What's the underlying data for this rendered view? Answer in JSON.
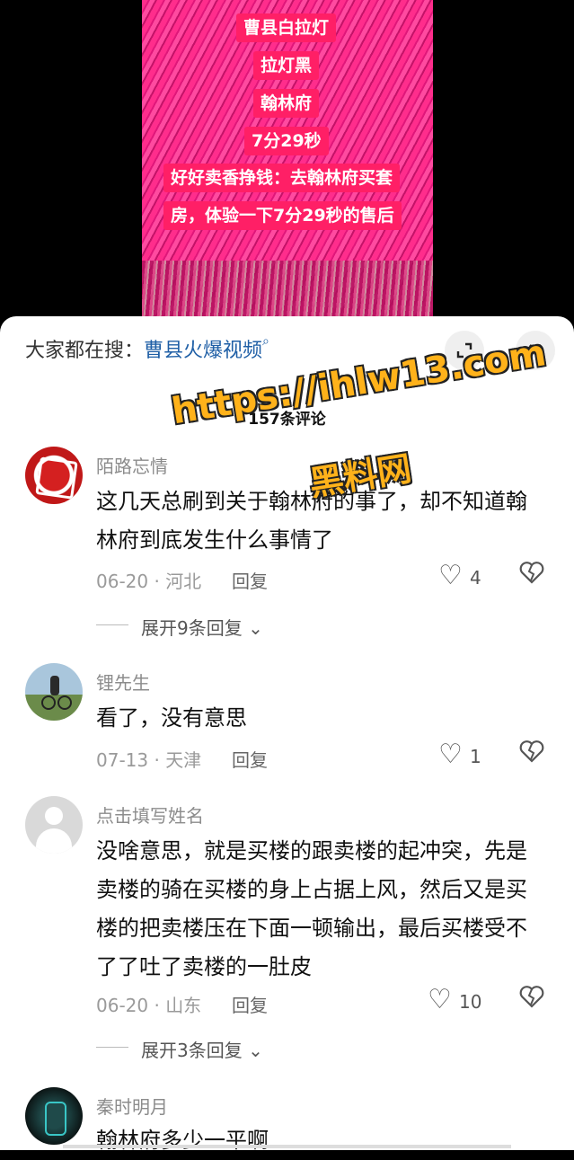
{
  "video": {
    "captions": [
      "曹县白拉灯",
      "拉灯黑",
      "翰林府",
      "7分29秒",
      "好好卖香挣钱：去翰林府买套",
      "房，体验一下7分29秒的售后"
    ]
  },
  "sheet": {
    "search_prefix": "大家都在搜：",
    "search_term": "曹县火爆视频",
    "comment_count": "157条评论"
  },
  "watermark": {
    "line1": "https://ihlw13.com",
    "line2": "黑料网"
  },
  "comments": [
    {
      "name": "陌路忘情",
      "text": "这几天总刷到关于翰林府的事了，却不知道翰林府到底发生什么事情了",
      "date_loc": "06-20 · 河北",
      "reply": "回复",
      "likes": "4",
      "expand": "展开9条回复"
    },
    {
      "name": "锂先生",
      "text": "看了，没有意思",
      "date_loc": "07-13 · 天津",
      "reply": "回复",
      "likes": "1"
    },
    {
      "name": "点击填写姓名",
      "text": "没啥意思，就是买楼的跟卖楼的起冲突，先是卖楼的骑在买楼的身上占据上风，然后又是买楼的把卖楼压在下面一顿输出，最后买楼受不了了吐了卖楼的一肚皮",
      "date_loc": "06-20 · 山东",
      "reply": "回复",
      "likes": "10",
      "expand": "展开3条回复"
    },
    {
      "name": "秦时明月",
      "text": "翰林府多少一平啊"
    }
  ],
  "colors": {
    "caption_bg": "#ff1f66",
    "link": "#1f5fa6",
    "watermark": "#ffb21a"
  },
  "icons": [
    "search-icon",
    "minimize-icon",
    "close-icon",
    "heart-icon",
    "broken-heart-icon",
    "chevron-down-icon"
  ]
}
